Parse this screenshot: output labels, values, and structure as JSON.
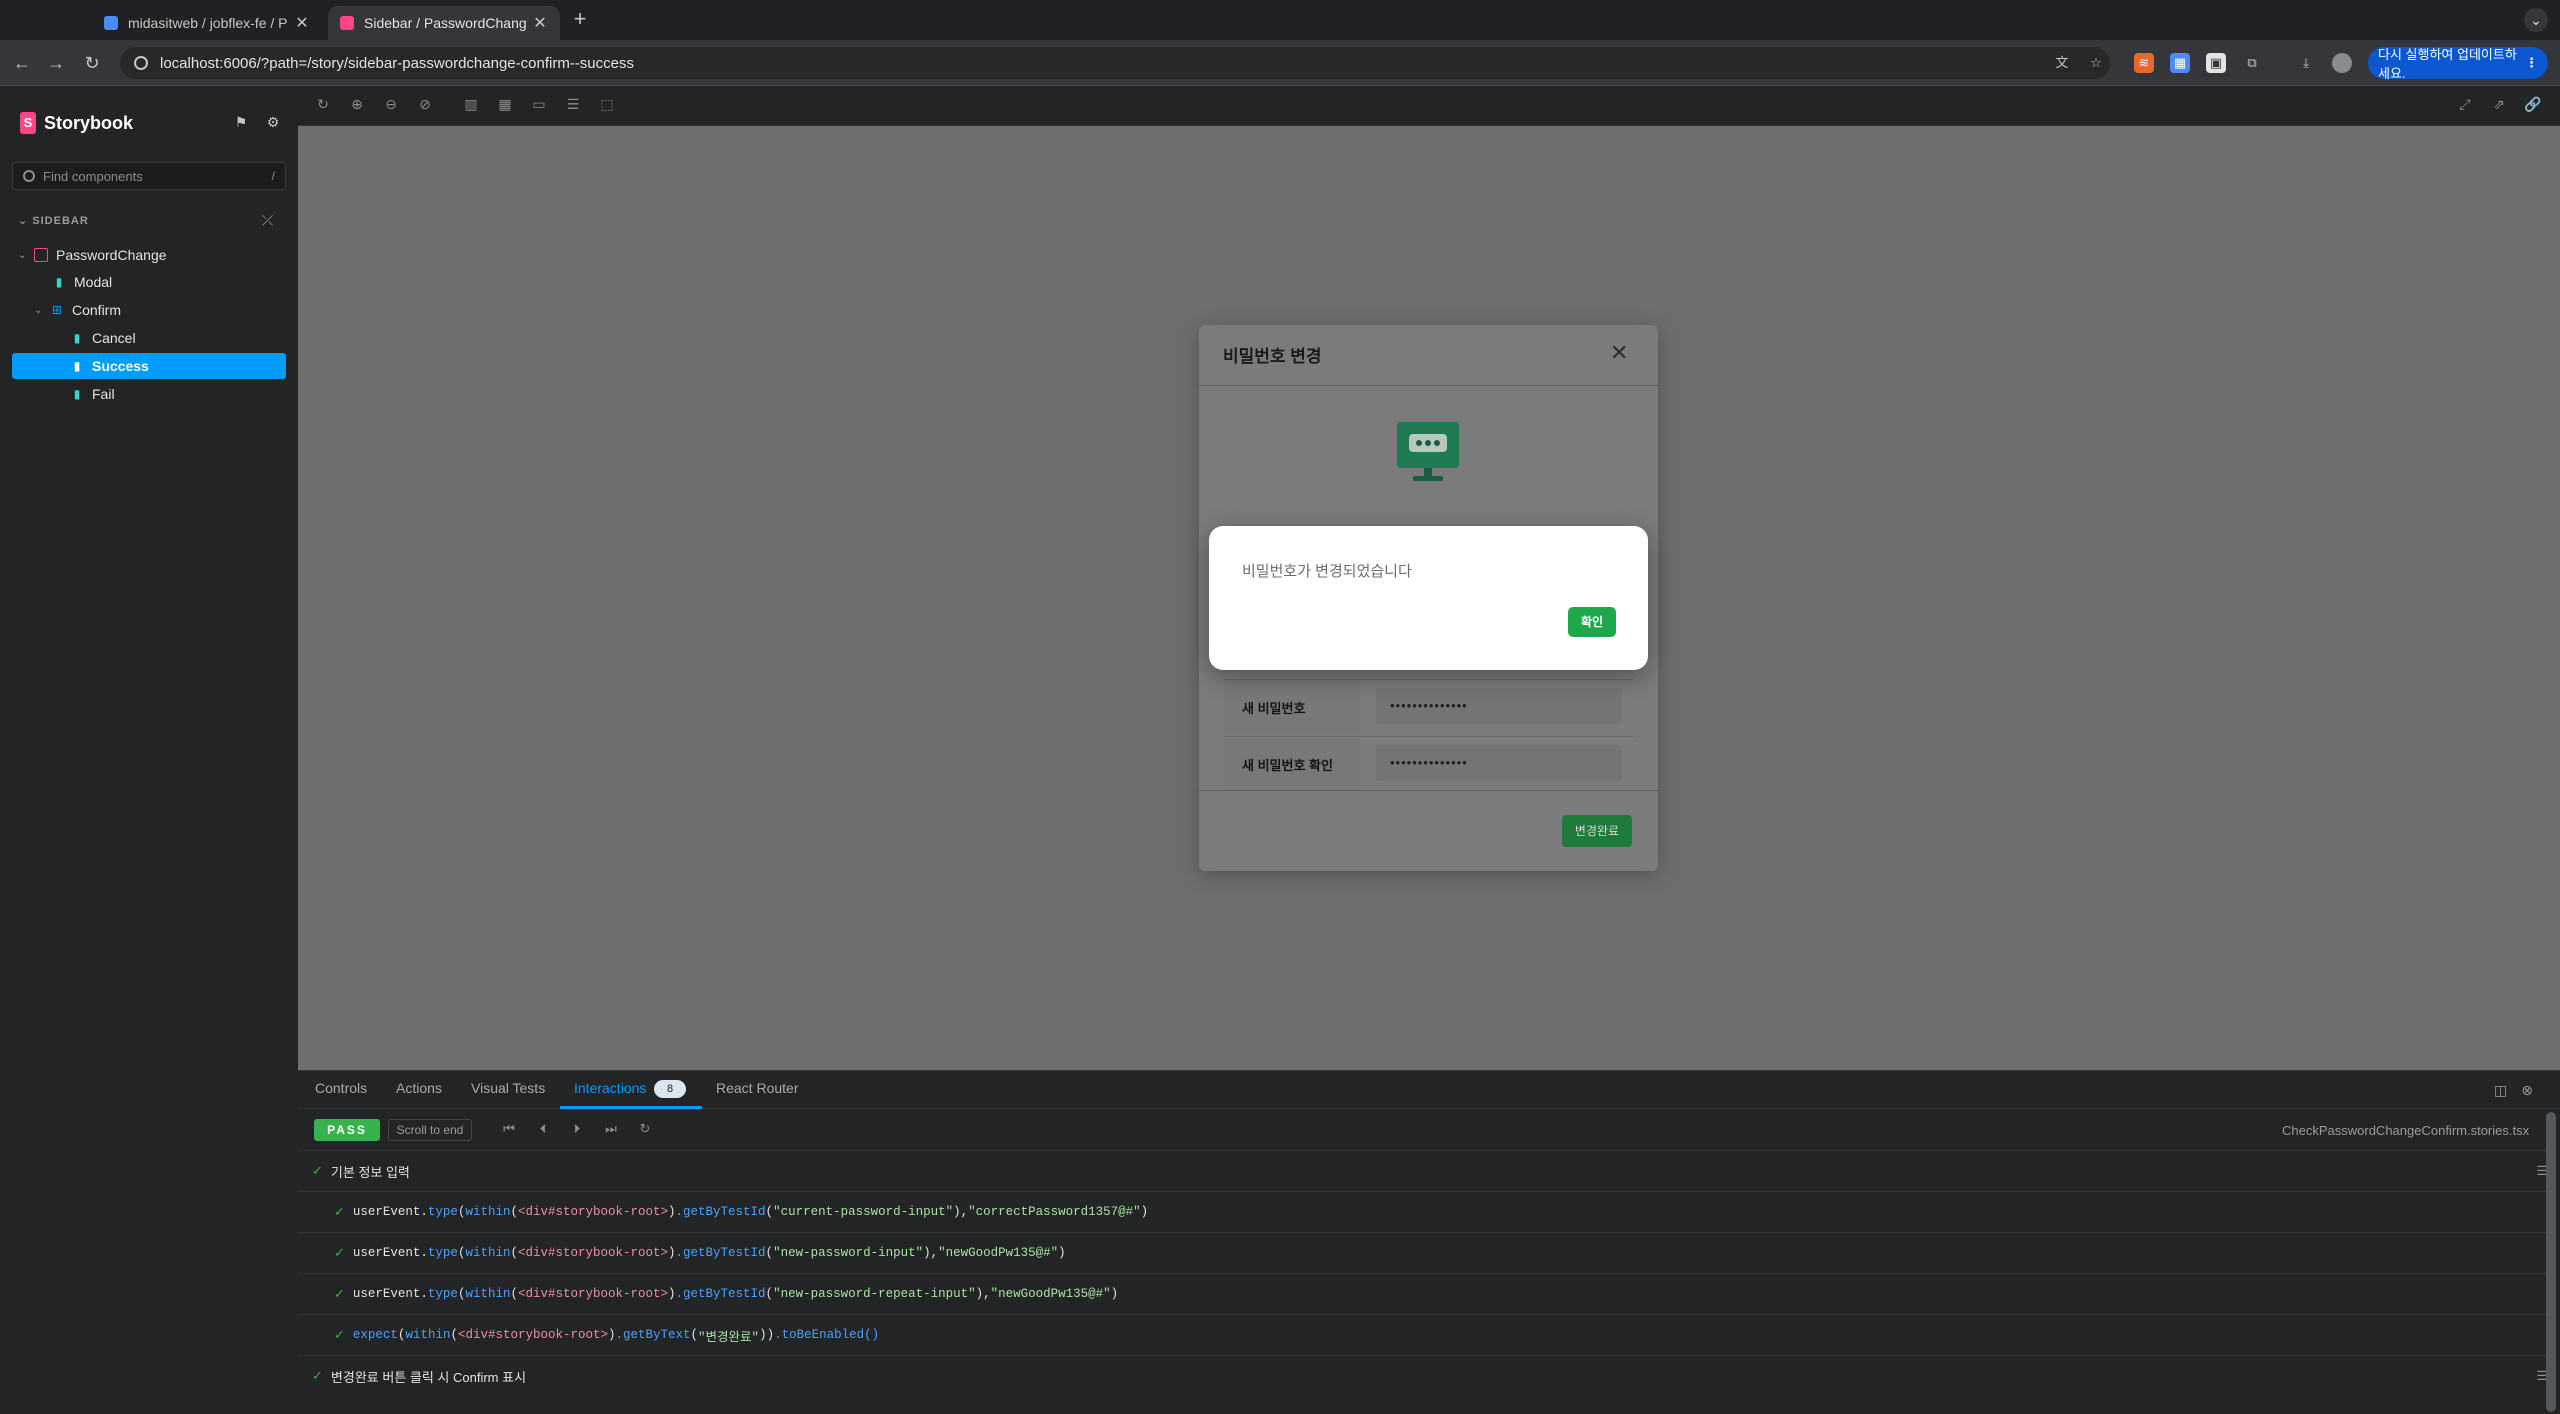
{
  "browser": {
    "tabs": [
      {
        "title": "midasitweb / jobflex-fe / Pull",
        "active": false
      },
      {
        "title": "Sidebar / PasswordChange / ",
        "active": true
      }
    ],
    "url": "localhost:6006/?path=/story/sidebar-passwordchange-confirm--success",
    "update_label": "다시 실행하여 업데이트하세요.",
    "update_dots": "⋮"
  },
  "storybook": {
    "brand": "Storybook",
    "search_placeholder": "Find components",
    "search_key": "/",
    "group_label": "SIDEBAR",
    "tree": [
      {
        "label": "PasswordChange",
        "type": "group"
      },
      {
        "label": "Modal",
        "type": "story"
      },
      {
        "label": "Confirm",
        "type": "component"
      },
      {
        "label": "Cancel",
        "type": "story"
      },
      {
        "label": "Success",
        "type": "story",
        "selected": true
      },
      {
        "label": "Fail",
        "type": "story"
      }
    ]
  },
  "preview": {
    "modal_title": "비밀번호 변경",
    "fields": [
      {
        "label": "새 비밀번호",
        "value": "••••••••••••••"
      },
      {
        "label": "새 비밀번호 확인",
        "value": "••••••••••••••"
      }
    ],
    "submit_label": "변경완료",
    "dialog_message": "비밀번호가 변경되었습니다",
    "dialog_ok": "확인"
  },
  "addons": {
    "tabs": [
      "Controls",
      "Actions",
      "Visual Tests",
      "Interactions",
      "React Router"
    ],
    "interactions_count": "8",
    "status": "PASS",
    "scroll_to_end": "Scroll to end",
    "filename": "CheckPasswordChangeConfirm.stories.tsx",
    "steps": [
      {
        "kind": "group",
        "text": "기본 정보 입력"
      },
      {
        "kind": "call",
        "obj": "userEvent.",
        "fn": "type",
        "within": "within",
        "root": "<div#storybook-root>",
        "getter": ".getByTestId",
        "arg": "\"current-password-input\"",
        "value": "\"correctPassword1357@#\""
      },
      {
        "kind": "call",
        "obj": "userEvent.",
        "fn": "type",
        "within": "within",
        "root": "<div#storybook-root>",
        "getter": ".getByTestId",
        "arg": "\"new-password-input\"",
        "value": "\"newGoodPw135@#\""
      },
      {
        "kind": "call",
        "obj": "userEvent.",
        "fn": "type",
        "within": "within",
        "root": "<div#storybook-root>",
        "getter": ".getByTestId",
        "arg": "\"new-password-repeat-input\"",
        "value": "\"newGoodPw135@#\""
      },
      {
        "kind": "expect",
        "fn": "expect",
        "within": "within",
        "root": "<div#storybook-root>",
        "getter": ".getByText",
        "arg": "\"변경완료\"",
        "matcher": ".toBeEnabled()"
      },
      {
        "kind": "group",
        "text": "변경완료 버튼 클릭 시 Confirm 표시"
      }
    ]
  },
  "colors": {
    "accent": "#029cfd",
    "pass": "#37b24d",
    "brand": "#ff4785",
    "ok_button": "#1fa84a"
  }
}
